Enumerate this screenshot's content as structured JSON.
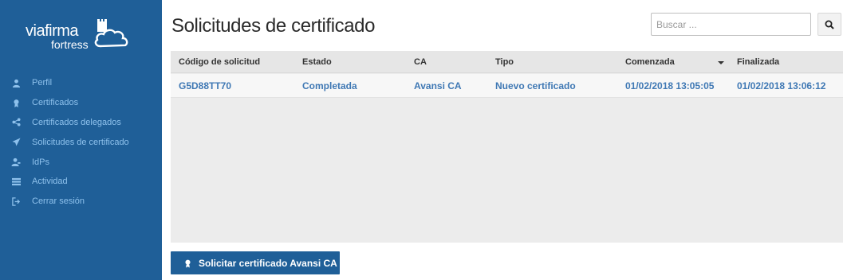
{
  "sidebar": {
    "brand": "viafirma",
    "brand_sub": "fortress",
    "items": [
      {
        "label": "Perfil",
        "icon": "user-icon"
      },
      {
        "label": "Certificados",
        "icon": "certificate-icon"
      },
      {
        "label": "Certificados delegados",
        "icon": "share-icon"
      },
      {
        "label": "Solicitudes de certificado",
        "icon": "send-icon"
      },
      {
        "label": "IdPs",
        "icon": "user-group-icon"
      },
      {
        "label": "Actividad",
        "icon": "list-icon"
      },
      {
        "label": "Cerrar sesión",
        "icon": "sign-out-icon"
      }
    ]
  },
  "header": {
    "title": "Solicitudes de certificado"
  },
  "search": {
    "placeholder": "Buscar ..."
  },
  "table": {
    "columns": [
      "Código de solicitud",
      "Estado",
      "CA",
      "Tipo",
      "Comenzada",
      "Finalizada"
    ],
    "sorted_column": "Comenzada",
    "rows": [
      {
        "codigo": "G5D88TT70",
        "estado": "Completada",
        "ca": "Avansi CA",
        "tipo": "Nuevo certificado",
        "comenzada": "01/02/2018 13:05:05",
        "finalizada": "01/02/2018 13:06:12"
      }
    ]
  },
  "action": {
    "label": "Solicitar certificado Avansi CA"
  },
  "colors": {
    "sidebar_bg": "#1f5f98",
    "sidebar_text": "#8ec1ec",
    "link": "#3f78b4",
    "button_bg": "#1f5f98"
  }
}
